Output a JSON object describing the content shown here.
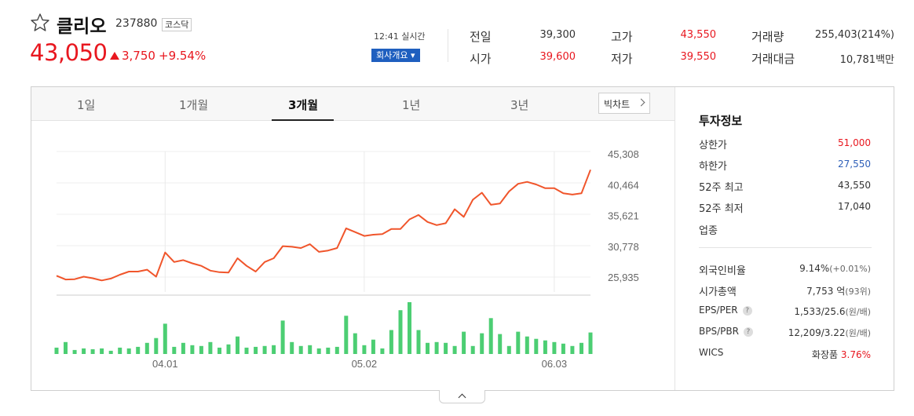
{
  "stock": {
    "name": "클리오",
    "code": "237880",
    "market": "코스닥",
    "price": "43,050",
    "change": "3,750",
    "change_rate": "+9.54%",
    "realtime": "12:41 실시간",
    "company_button": "회사개요 ▾"
  },
  "quote": {
    "prev_label": "전일",
    "prev": "39,300",
    "open_label": "시가",
    "open": "39,600",
    "high_label": "고가",
    "high": "43,550",
    "low_label": "저가",
    "low": "39,550",
    "volume_label": "거래량",
    "volume": "255,403(214%)",
    "amount_label": "거래대금",
    "amount": "10,781백만"
  },
  "tabs": [
    {
      "label": "1일"
    },
    {
      "label": "1개월"
    },
    {
      "label": "3개월"
    },
    {
      "label": "1년"
    },
    {
      "label": "3년"
    }
  ],
  "big_chart_label": "빅차트",
  "colors": {
    "up": "#e8171f",
    "down": "#2e5fb8",
    "line": "#f0552b",
    "volume": "#4cce73",
    "button": "#1f5fbf"
  },
  "chart_data": {
    "type": "line",
    "y_ticks": [
      "45,308",
      "40,464",
      "35,621",
      "30,778",
      "25,935"
    ],
    "y_tick_values": [
      45308,
      40464,
      35621,
      30778,
      25935
    ],
    "x_ticks": [
      {
        "label": "04.01",
        "index": 12
      },
      {
        "label": "05.02",
        "index": 34
      },
      {
        "label": "06.03",
        "index": 55
      }
    ],
    "price": [
      26150,
      25550,
      25600,
      26000,
      25750,
      25400,
      25700,
      26300,
      26800,
      26800,
      27100,
      26000,
      29800,
      28300,
      28600,
      28100,
      27700,
      26950,
      26700,
      26650,
      28900,
      27700,
      26800,
      28300,
      28900,
      30800,
      30700,
      30500,
      31100,
      29900,
      30100,
      30500,
      33600,
      33000,
      32400,
      32600,
      32700,
      33500,
      33500,
      35000,
      35700,
      34600,
      34100,
      34400,
      36600,
      35400,
      38100,
      39200,
      37300,
      37500,
      39400,
      40600,
      40900,
      40500,
      39900,
      39900,
      39100,
      38900,
      39100,
      42800
    ],
    "volume": [
      8,
      15,
      5,
      7,
      6,
      7,
      4,
      8,
      7,
      9,
      14,
      20,
      38,
      9,
      14,
      11,
      10,
      15,
      8,
      12,
      22,
      8,
      9,
      10,
      11,
      42,
      15,
      10,
      11,
      7,
      8,
      9,
      48,
      26,
      11,
      18,
      7,
      30,
      55,
      65,
      30,
      14,
      15,
      14,
      10,
      28,
      10,
      26,
      45,
      25,
      10,
      28,
      22,
      19,
      17,
      15,
      13,
      10,
      14,
      27
    ]
  },
  "info": {
    "title": "투자정보",
    "upper_label": "상한가",
    "upper": "51,000",
    "lower_label": "하한가",
    "lower": "27,550",
    "high52_label": "52주 최고",
    "high52": "43,550",
    "low52_label": "52주 최저",
    "low52": "17,040",
    "sector_label": "업종",
    "foreign_label": "외국인비율",
    "foreign": "9.14%",
    "foreign_change": "(+0.01%)",
    "mcap_label": "시가총액",
    "mcap": "7,753 억",
    "mcap_rank": "(93위)",
    "eps_label": "EPS/PER",
    "eps": "1,533/25.6",
    "eps_unit": "(원/배)",
    "bps_label": "BPS/PBR",
    "bps": "12,209/3.22",
    "bps_unit": "(원/배)",
    "wics_label": "WICS",
    "wics": "화장품",
    "wics_rate": "3.76%",
    "help_glyph": "?"
  }
}
